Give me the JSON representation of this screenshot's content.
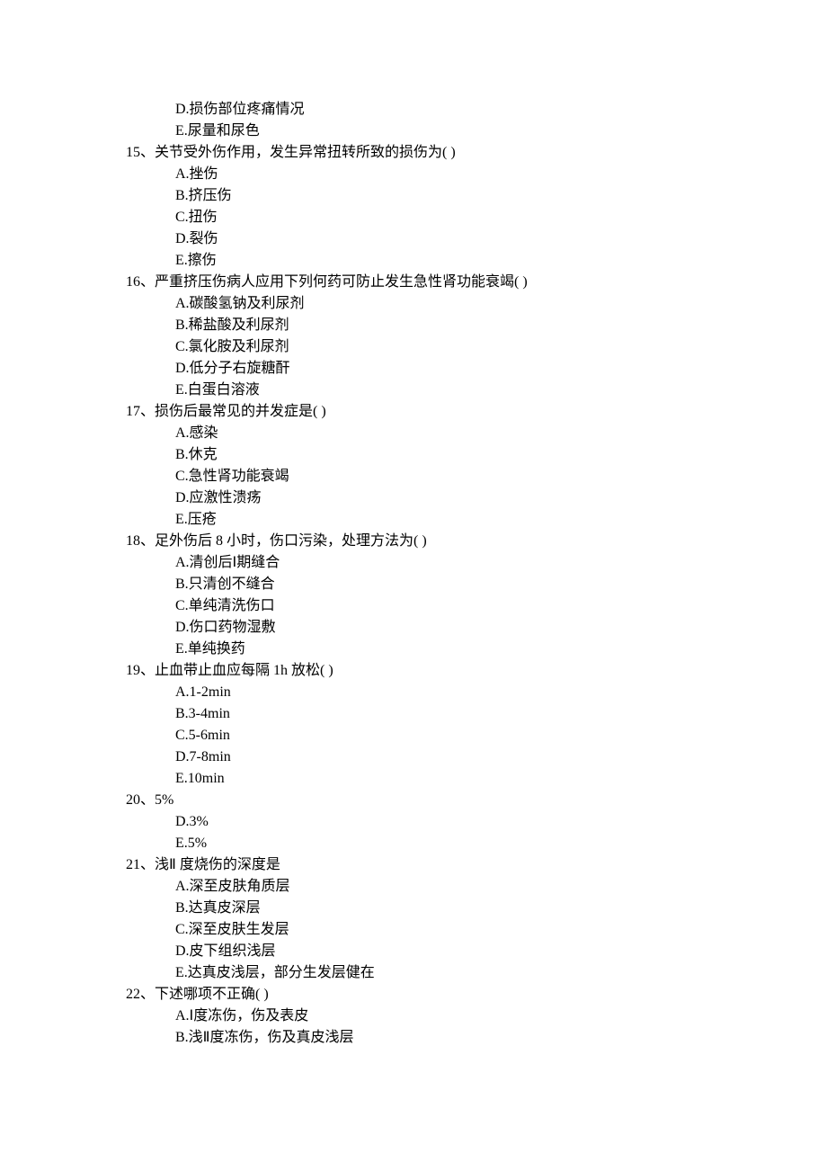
{
  "lines": [
    {
      "type": "option",
      "text": "D.损伤部位疼痛情况"
    },
    {
      "type": "option",
      "text": "E.尿量和尿色"
    },
    {
      "type": "question",
      "text": "15、关节受外伤作用，发生异常扭转所致的损伤为( )"
    },
    {
      "type": "option",
      "text": "A.挫伤"
    },
    {
      "type": "option",
      "text": "B.挤压伤"
    },
    {
      "type": "option",
      "text": "C.扭伤"
    },
    {
      "type": "option",
      "text": "D.裂伤"
    },
    {
      "type": "option",
      "text": "E.擦伤"
    },
    {
      "type": "question",
      "text": "16、严重挤压伤病人应用下列何药可防止发生急性肾功能衰竭( )"
    },
    {
      "type": "option",
      "text": "A.碳酸氢钠及利尿剂"
    },
    {
      "type": "option",
      "text": "B.稀盐酸及利尿剂"
    },
    {
      "type": "option",
      "text": "C.氯化胺及利尿剂"
    },
    {
      "type": "option",
      "text": "D.低分子右旋糖酐"
    },
    {
      "type": "option",
      "text": "E.白蛋白溶液"
    },
    {
      "type": "question",
      "text": "17、损伤后最常见的并发症是( )"
    },
    {
      "type": "option",
      "text": "A.感染"
    },
    {
      "type": "option",
      "text": "B.休克"
    },
    {
      "type": "option",
      "text": "C.急性肾功能衰竭"
    },
    {
      "type": "option",
      "text": "D.应激性溃疡"
    },
    {
      "type": "option",
      "text": "E.压疮"
    },
    {
      "type": "question",
      "text": "18、足外伤后 8 小时，伤口污染，处理方法为( )"
    },
    {
      "type": "option",
      "text": "A.清创后Ⅰ期缝合"
    },
    {
      "type": "option",
      "text": "B.只清创不缝合"
    },
    {
      "type": "option",
      "text": "C.单纯清洗伤口"
    },
    {
      "type": "option",
      "text": "D.伤口药物湿敷"
    },
    {
      "type": "option",
      "text": "E.单纯换药"
    },
    {
      "type": "question",
      "text": "19、止血带止血应每隔 1h 放松( )"
    },
    {
      "type": "option",
      "text": "A.1-2min"
    },
    {
      "type": "option",
      "text": "B.3-4min"
    },
    {
      "type": "option",
      "text": "C.5-6min"
    },
    {
      "type": "option",
      "text": "D.7-8min"
    },
    {
      "type": "option",
      "text": "E.10min"
    },
    {
      "type": "question",
      "text": "20、5%"
    },
    {
      "type": "option",
      "text": "D.3%"
    },
    {
      "type": "option",
      "text": "E.5%"
    },
    {
      "type": "question",
      "text": "21、浅Ⅱ 度烧伤的深度是"
    },
    {
      "type": "option",
      "text": "A.深至皮肤角质层"
    },
    {
      "type": "option",
      "text": "B.达真皮深层"
    },
    {
      "type": "option",
      "text": "C.深至皮肤生发层"
    },
    {
      "type": "option",
      "text": "D.皮下组织浅层"
    },
    {
      "type": "option",
      "text": "E.达真皮浅层，部分生发层健在"
    },
    {
      "type": "question",
      "text": "22、下述哪项不正确( )"
    },
    {
      "type": "option",
      "text": "A.Ⅰ度冻伤，伤及表皮"
    },
    {
      "type": "option",
      "text": "B.浅Ⅱ度冻伤，伤及真皮浅层"
    }
  ]
}
